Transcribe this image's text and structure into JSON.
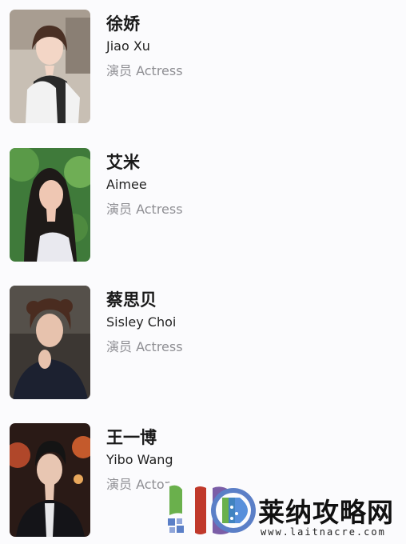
{
  "cast": [
    {
      "name_cn": "徐娇",
      "name_en": "Jiao Xu",
      "role": "演员 Actress",
      "photo_icon": "portrait-photo"
    },
    {
      "name_cn": "艾米",
      "name_en": "Aimee",
      "role": "演员 Actress",
      "photo_icon": "portrait-photo"
    },
    {
      "name_cn": "蔡思贝",
      "name_en": "Sisley Choi",
      "role": "演员 Actress",
      "photo_icon": "portrait-photo"
    },
    {
      "name_cn": "王一博",
      "name_en": "Yibo Wang",
      "role": "演员 Actor",
      "photo_icon": "portrait-photo"
    }
  ],
  "watermark": {
    "title": "莱纳攻略网",
    "url": "www.laitnacre.com",
    "logo_icon": "site-logo-icon",
    "colors": {
      "green": "#6ab04c",
      "blue": "#5b7fc7",
      "red": "#c0392b",
      "purple": "#7b5ea7"
    }
  }
}
